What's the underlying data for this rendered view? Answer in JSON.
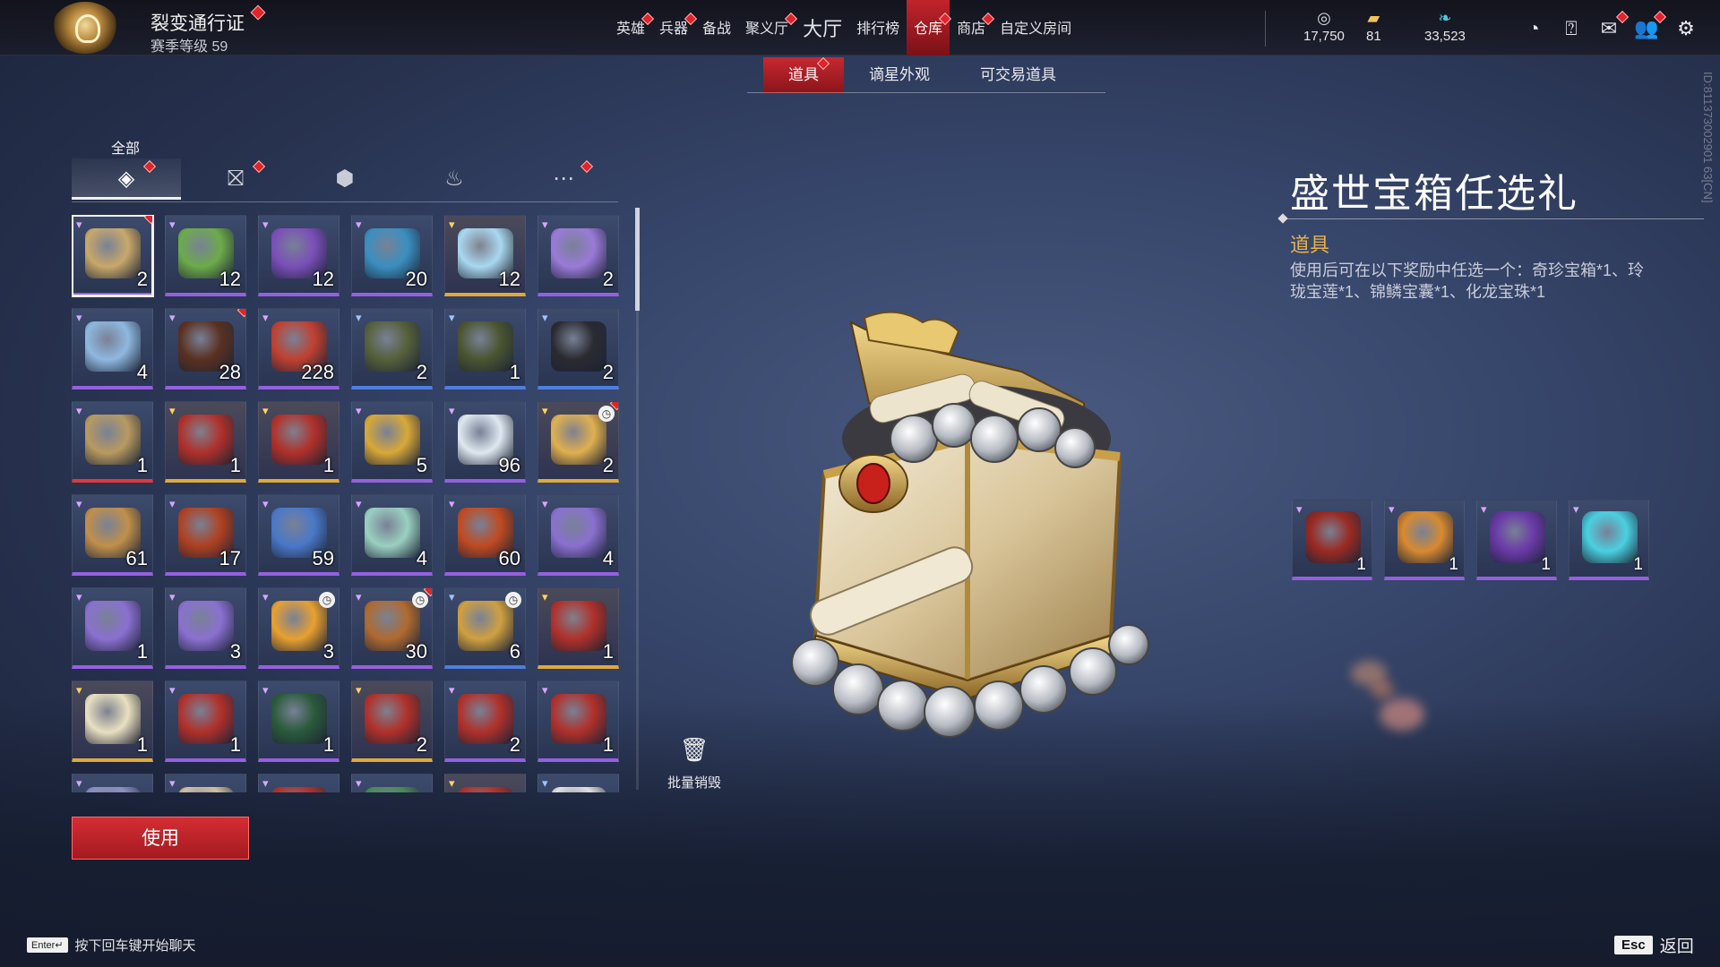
{
  "header": {
    "pass_title": "裂变通行证",
    "season_level": "赛季等级 59",
    "nav": [
      {
        "label": "英雄",
        "dot": true,
        "big": false,
        "active": false
      },
      {
        "label": "兵器",
        "dot": true,
        "big": false,
        "active": false
      },
      {
        "label": "备战",
        "dot": false,
        "big": false,
        "active": false
      },
      {
        "label": "聚义厅",
        "dot": true,
        "big": false,
        "active": false
      },
      {
        "label": "大厅",
        "dot": false,
        "big": true,
        "active": false
      },
      {
        "label": "排行榜",
        "dot": false,
        "big": false,
        "active": false
      },
      {
        "label": "仓库",
        "dot": true,
        "big": false,
        "active": true
      },
      {
        "label": "商店",
        "dot": true,
        "big": false,
        "active": false
      },
      {
        "label": "自定义房间",
        "dot": false,
        "big": false,
        "active": false
      }
    ],
    "currencies": [
      {
        "icon": "coin-stack-icon",
        "glyph": "◎",
        "value": "17,750",
        "color": "#d9d9e0"
      },
      {
        "icon": "ticket-icon",
        "glyph": "▰",
        "value": "81",
        "color": "#f0c45a"
      },
      {
        "icon": "jade-feather-icon",
        "glyph": "❧",
        "value": "33,523",
        "color": "#4fc6e0"
      }
    ]
  },
  "subtabs": [
    {
      "label": "道具",
      "active": true,
      "dot": true
    },
    {
      "label": "谪星外观",
      "active": false,
      "dot": false
    },
    {
      "label": "可交易道具",
      "active": false,
      "dot": false
    }
  ],
  "category": {
    "label": "全部",
    "tabs": [
      {
        "icon": "layers-icon",
        "glyph": "◈",
        "active": true,
        "dot": true
      },
      {
        "icon": "gift-icon",
        "glyph": "⛝",
        "active": false,
        "dot": true
      },
      {
        "icon": "token-icon",
        "glyph": "⬢",
        "active": false,
        "dot": false
      },
      {
        "icon": "flame-icon",
        "glyph": "♨",
        "active": false,
        "dot": false
      },
      {
        "icon": "more-icon",
        "glyph": "⋯",
        "active": false,
        "dot": true
      }
    ]
  },
  "inventory": [
    {
      "count": "2",
      "quality": "purple",
      "art": "#c9a86a",
      "selected": true,
      "dot": true,
      "timer": false
    },
    {
      "count": "12",
      "quality": "purple",
      "art": "#6cab4a",
      "selected": false,
      "dot": false,
      "timer": false
    },
    {
      "count": "12",
      "quality": "purple",
      "art": "#7a4fb8",
      "selected": false,
      "dot": false,
      "timer": false
    },
    {
      "count": "20",
      "quality": "purple",
      "art": "#3a8fc0",
      "selected": false,
      "dot": false,
      "timer": false
    },
    {
      "count": "12",
      "quality": "gold",
      "art": "#a8d8f0",
      "selected": false,
      "dot": false,
      "timer": false
    },
    {
      "count": "2",
      "quality": "purple",
      "art": "#9a7ad8",
      "selected": false,
      "dot": false,
      "timer": false
    },
    {
      "count": "4",
      "quality": "purple",
      "art": "#8fb8e0",
      "selected": false,
      "dot": false,
      "timer": false
    },
    {
      "count": "28",
      "quality": "purple",
      "art": "#5a3020",
      "selected": false,
      "dot": true,
      "timer": false
    },
    {
      "count": "228",
      "quality": "purple",
      "art": "#c04030",
      "selected": false,
      "dot": false,
      "timer": false
    },
    {
      "count": "2",
      "quality": "blue",
      "art": "#55603a",
      "selected": false,
      "dot": false,
      "timer": false
    },
    {
      "count": "1",
      "quality": "blue",
      "art": "#4a5530",
      "selected": false,
      "dot": false,
      "timer": false
    },
    {
      "count": "2",
      "quality": "blue",
      "art": "#2a2a30",
      "selected": false,
      "dot": false,
      "timer": false
    },
    {
      "count": "1",
      "quality": "red",
      "art": "#b89a60",
      "selected": false,
      "dot": false,
      "timer": false
    },
    {
      "count": "1",
      "quality": "gold",
      "art": "#b0302a",
      "selected": false,
      "dot": false,
      "timer": false
    },
    {
      "count": "1",
      "quality": "gold",
      "art": "#b0302a",
      "selected": false,
      "dot": false,
      "timer": false
    },
    {
      "count": "5",
      "quality": "purple",
      "art": "#d8a838",
      "selected": false,
      "dot": false,
      "timer": false
    },
    {
      "count": "96",
      "quality": "purple",
      "art": "#dfe8f0",
      "selected": false,
      "dot": false,
      "timer": false
    },
    {
      "count": "2",
      "quality": "gold",
      "art": "#e0b050",
      "selected": false,
      "dot": true,
      "timer": true
    },
    {
      "count": "61",
      "quality": "purple",
      "art": "#c0904a",
      "selected": false,
      "dot": false,
      "timer": false
    },
    {
      "count": "17",
      "quality": "purple",
      "art": "#b04020",
      "selected": false,
      "dot": false,
      "timer": false
    },
    {
      "count": "59",
      "quality": "purple",
      "art": "#4a78c8",
      "selected": false,
      "dot": false,
      "timer": false
    },
    {
      "count": "4",
      "quality": "purple",
      "art": "#9ad0c0",
      "selected": false,
      "dot": false,
      "timer": false
    },
    {
      "count": "60",
      "quality": "purple",
      "art": "#c04a20",
      "selected": false,
      "dot": false,
      "timer": false
    },
    {
      "count": "4",
      "quality": "purple",
      "art": "#8a70d0",
      "selected": false,
      "dot": false,
      "timer": false
    },
    {
      "count": "1",
      "quality": "purple",
      "art": "#8a70d0",
      "selected": false,
      "dot": false,
      "timer": false
    },
    {
      "count": "3",
      "quality": "purple",
      "art": "#8a70d0",
      "selected": false,
      "dot": false,
      "timer": false
    },
    {
      "count": "3",
      "quality": "purple",
      "art": "#e8a030",
      "selected": false,
      "dot": false,
      "timer": true
    },
    {
      "count": "30",
      "quality": "purple",
      "art": "#b06a30",
      "selected": false,
      "dot": true,
      "timer": true
    },
    {
      "count": "6",
      "quality": "blue",
      "art": "#d0a040",
      "selected": false,
      "dot": false,
      "timer": true
    },
    {
      "count": "1",
      "quality": "gold",
      "art": "#b0302a",
      "selected": false,
      "dot": false,
      "timer": false
    },
    {
      "count": "1",
      "quality": "gold",
      "art": "#e8e0c0",
      "selected": false,
      "dot": false,
      "timer": false
    },
    {
      "count": "1",
      "quality": "purple",
      "art": "#b0302a",
      "selected": false,
      "dot": false,
      "timer": false
    },
    {
      "count": "1",
      "quality": "purple",
      "art": "#2a5a3a",
      "selected": false,
      "dot": false,
      "timer": false
    },
    {
      "count": "2",
      "quality": "gold",
      "art": "#b0302a",
      "selected": false,
      "dot": false,
      "timer": false
    },
    {
      "count": "2",
      "quality": "purple",
      "art": "#b0302a",
      "selected": false,
      "dot": false,
      "timer": false
    },
    {
      "count": "1",
      "quality": "purple",
      "art": "#b0302a",
      "selected": false,
      "dot": false,
      "timer": false
    },
    {
      "count": "",
      "quality": "purple",
      "art": "#8a90c0",
      "selected": false,
      "dot": false,
      "timer": false
    },
    {
      "count": "",
      "quality": "purple",
      "art": "#d0c0a0",
      "selected": false,
      "dot": false,
      "timer": false
    },
    {
      "count": "",
      "quality": "purple",
      "art": "#b0302a",
      "selected": false,
      "dot": false,
      "timer": false
    },
    {
      "count": "",
      "quality": "purple",
      "art": "#4a8a5a",
      "selected": false,
      "dot": false,
      "timer": false
    },
    {
      "count": "",
      "quality": "gold",
      "art": "#b0302a",
      "selected": false,
      "dot": false,
      "timer": false
    },
    {
      "count": "",
      "quality": "blue",
      "art": "#e0e0e0",
      "selected": false,
      "dot": false,
      "timer": false
    }
  ],
  "actions": {
    "bulk_destroy": "批量销毁",
    "use": "使用"
  },
  "detail": {
    "title": "盛世宝箱任选礼",
    "type": "道具",
    "description": "使用后可在以下奖励中任选一个：奇珍宝箱*1、玲珑宝莲*1、锦鳞宝囊*1、化龙宝珠*1",
    "rewards": [
      {
        "count": "1",
        "art": "#9a2a22"
      },
      {
        "count": "1",
        "art": "#d88a30"
      },
      {
        "count": "1",
        "art": "#6a3aa8"
      },
      {
        "count": "1",
        "art": "#4ad0e0"
      }
    ]
  },
  "side_id": "ID:811373002901 63[CN]",
  "footer": {
    "enter_key": "Enter↵",
    "chat_hint": "按下回车键开始聊天",
    "esc_key": "Esc",
    "back_label": "返回"
  }
}
